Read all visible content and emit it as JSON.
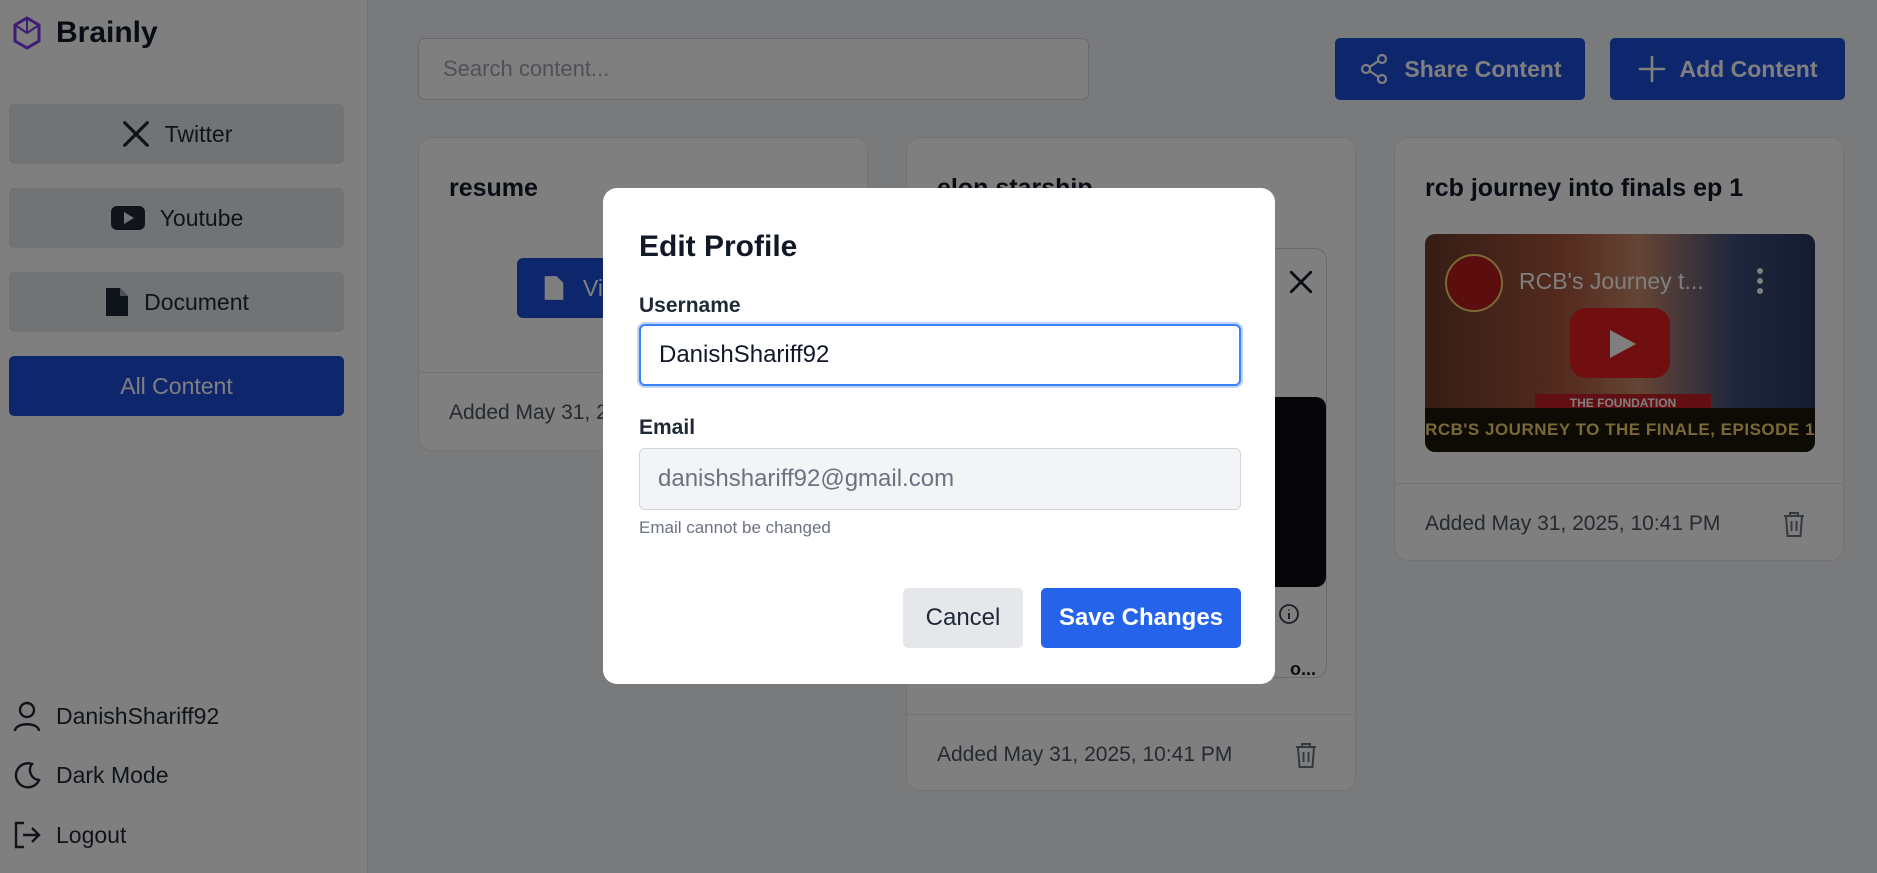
{
  "app": {
    "name": "Brainly"
  },
  "sidebar": {
    "items": [
      {
        "label": "Twitter",
        "icon": "x-logo-icon",
        "active": false
      },
      {
        "label": "Youtube",
        "icon": "youtube-icon",
        "active": false
      },
      {
        "label": "Document",
        "icon": "document-icon",
        "active": false
      },
      {
        "label": "All Content",
        "icon": "",
        "active": true
      }
    ],
    "footer": {
      "user": "DanishShariff92",
      "dark_mode": "Dark Mode",
      "logout": "Logout"
    }
  },
  "header": {
    "search_placeholder": "Search content...",
    "share_label": "Share Content",
    "add_label": "Add Content"
  },
  "cards": [
    {
      "title": "resume",
      "type": "document",
      "button_label": "Vi",
      "date": "Added May 31, 2"
    },
    {
      "title": "elon starship",
      "type": "twitter",
      "date": "Added May 31, 2025, 10:41 PM",
      "tweet_tail": "o..."
    },
    {
      "title": "rcb journey into finals ep 1",
      "type": "youtube",
      "video_title": "RCB's Journey t...",
      "video_banner": "THE FOUNDATION",
      "video_caption": "RCB'S JOURNEY TO THE FINALE, EPISODE 1",
      "date": "Added May 31, 2025, 10:41 PM"
    }
  ],
  "modal": {
    "title": "Edit Profile",
    "username_label": "Username",
    "username_value": "DanishShariff92",
    "email_label": "Email",
    "email_value": "danishshariff92@gmail.com",
    "email_hint": "Email cannot be changed",
    "cancel_label": "Cancel",
    "save_label": "Save Changes"
  },
  "colors": {
    "primary": "#1d4ed8",
    "save": "#2563eb",
    "focus": "#3b82f6",
    "brand_icon": "#7c3aed"
  }
}
